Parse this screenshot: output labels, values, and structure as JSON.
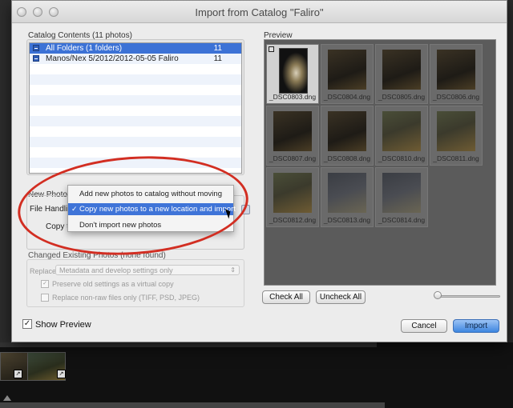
{
  "window": {
    "title": "Import from Catalog \"Faliro\""
  },
  "catalog": {
    "label": "Catalog Contents (11 photos)",
    "rows": [
      {
        "label": "All Folders (1 folders)",
        "count": "11"
      },
      {
        "label": "Manos/Nex 5/2012/2012-05-05 Faliro",
        "count": "11"
      }
    ]
  },
  "new_photos": {
    "label": "New Photos",
    "file_handling_label": "File Handling",
    "copy_label": "Copy t",
    "menu_items": [
      "Add new photos to catalog without moving",
      "Copy new photos to a new location and import",
      "Don't import new photos"
    ],
    "selected_check": "✓"
  },
  "changed": {
    "label": "Changed Existing Photos (none found)",
    "replace_label": "Replace:",
    "replace_value": "Metadata and develop settings only",
    "options": [
      {
        "label": "Preserve old settings as a virtual copy",
        "checked": "✓"
      },
      {
        "label": "Replace non-raw files only (TIFF, PSD, JPEG)",
        "checked": ""
      }
    ]
  },
  "preview": {
    "label": "Preview",
    "thumbnails": [
      "_DSC0803.dng",
      "_DSC0804.dng",
      "_DSC0805.dng",
      "_DSC0806.dng",
      "_DSC0807.dng",
      "_DSC0808.dng",
      "_DSC0810.dng",
      "_DSC0811.dng",
      "_DSC0812.dng",
      "_DSC0813.dng",
      "_DSC0814.dng"
    ]
  },
  "buttons": {
    "check_all": "Check All",
    "uncheck_all": "Uncheck All",
    "cancel": "Cancel",
    "import": "Import"
  },
  "show_preview": {
    "label": "Show Preview",
    "checked": "✓"
  },
  "colors": {
    "selection": "#3c72d6",
    "annotation": "#d22e22"
  }
}
